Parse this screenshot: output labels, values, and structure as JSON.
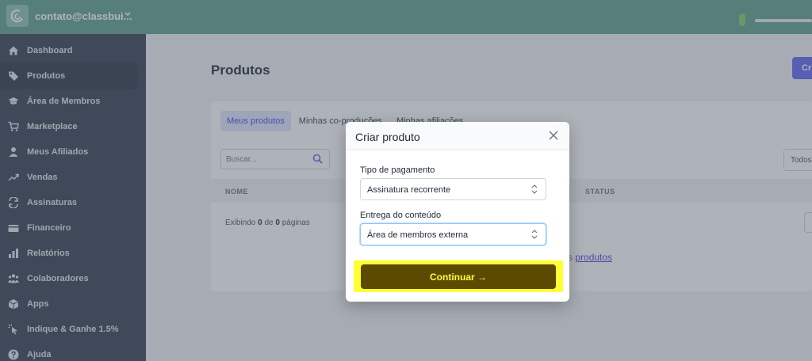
{
  "topbar": {
    "account": "contato@classbui...",
    "colors": {
      "background": "#5fa38d"
    }
  },
  "sidebar": {
    "items": [
      {
        "label": "Dashboard",
        "icon": "home-icon"
      },
      {
        "label": "Produtos",
        "icon": "tag-icon",
        "active": true
      },
      {
        "label": "Área de Membros",
        "icon": "graduation-cap-icon"
      },
      {
        "label": "Marketplace",
        "icon": "cart-icon"
      },
      {
        "label": "Meus Afiliados",
        "icon": "user-icon"
      },
      {
        "label": "Vendas",
        "icon": "trend-icon"
      },
      {
        "label": "Assinaturas",
        "icon": "refresh-icon"
      },
      {
        "label": "Financeiro",
        "icon": "wallet-icon"
      },
      {
        "label": "Relatórios",
        "icon": "bar-chart-icon"
      },
      {
        "label": "Colaboradores",
        "icon": "users-icon"
      },
      {
        "label": "Apps",
        "icon": "box-icon"
      },
      {
        "label": "Indique & Ganhe 1.5%",
        "icon": "pointer-icon"
      },
      {
        "label": "Ajuda",
        "icon": "help-icon"
      }
    ]
  },
  "main": {
    "title": "Produtos",
    "create_button": "Cri",
    "tabs": [
      "Meus produtos",
      "Minhas co-produções",
      "Minhas afiliações"
    ],
    "search_placeholder": "Buscar...",
    "filter_label": "Todos",
    "columns": {
      "name": "NOME",
      "status": "STATUS"
    },
    "footer": {
      "prefix": "Exibindo ",
      "shown": "0",
      "middle": " de ",
      "total": "0",
      "suffix": " páginas"
    },
    "empty": {
      "prefix": "s ",
      "link": "produtos"
    }
  },
  "modal": {
    "title": "Criar produto",
    "payment_label": "Tipo de pagamento",
    "payment_value": "Assinatura recorrente",
    "delivery_label": "Entrega do conteúdo",
    "delivery_value": "Área de membros externa",
    "continue_label": "Continuar →",
    "colors": {
      "button": "#5c4a00",
      "highlight": "#ffff33"
    }
  }
}
